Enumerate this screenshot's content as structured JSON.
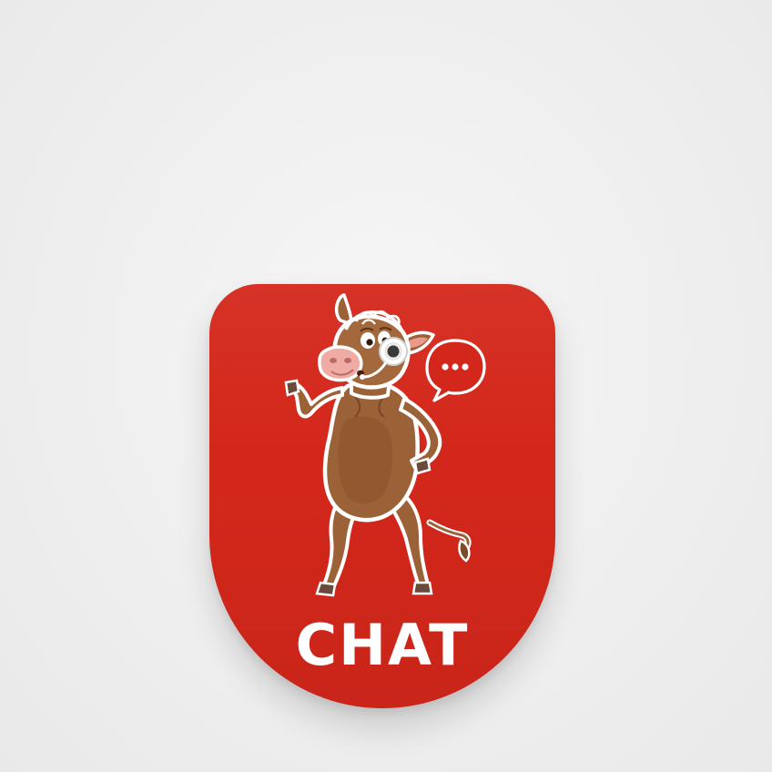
{
  "badge": {
    "label": "CHAT",
    "background_color": "#d4271b",
    "text_color": "#ffffff",
    "mascot_icon": "cow-with-headset-icon",
    "bubble_icon": "speech-bubble-ellipsis-icon"
  }
}
